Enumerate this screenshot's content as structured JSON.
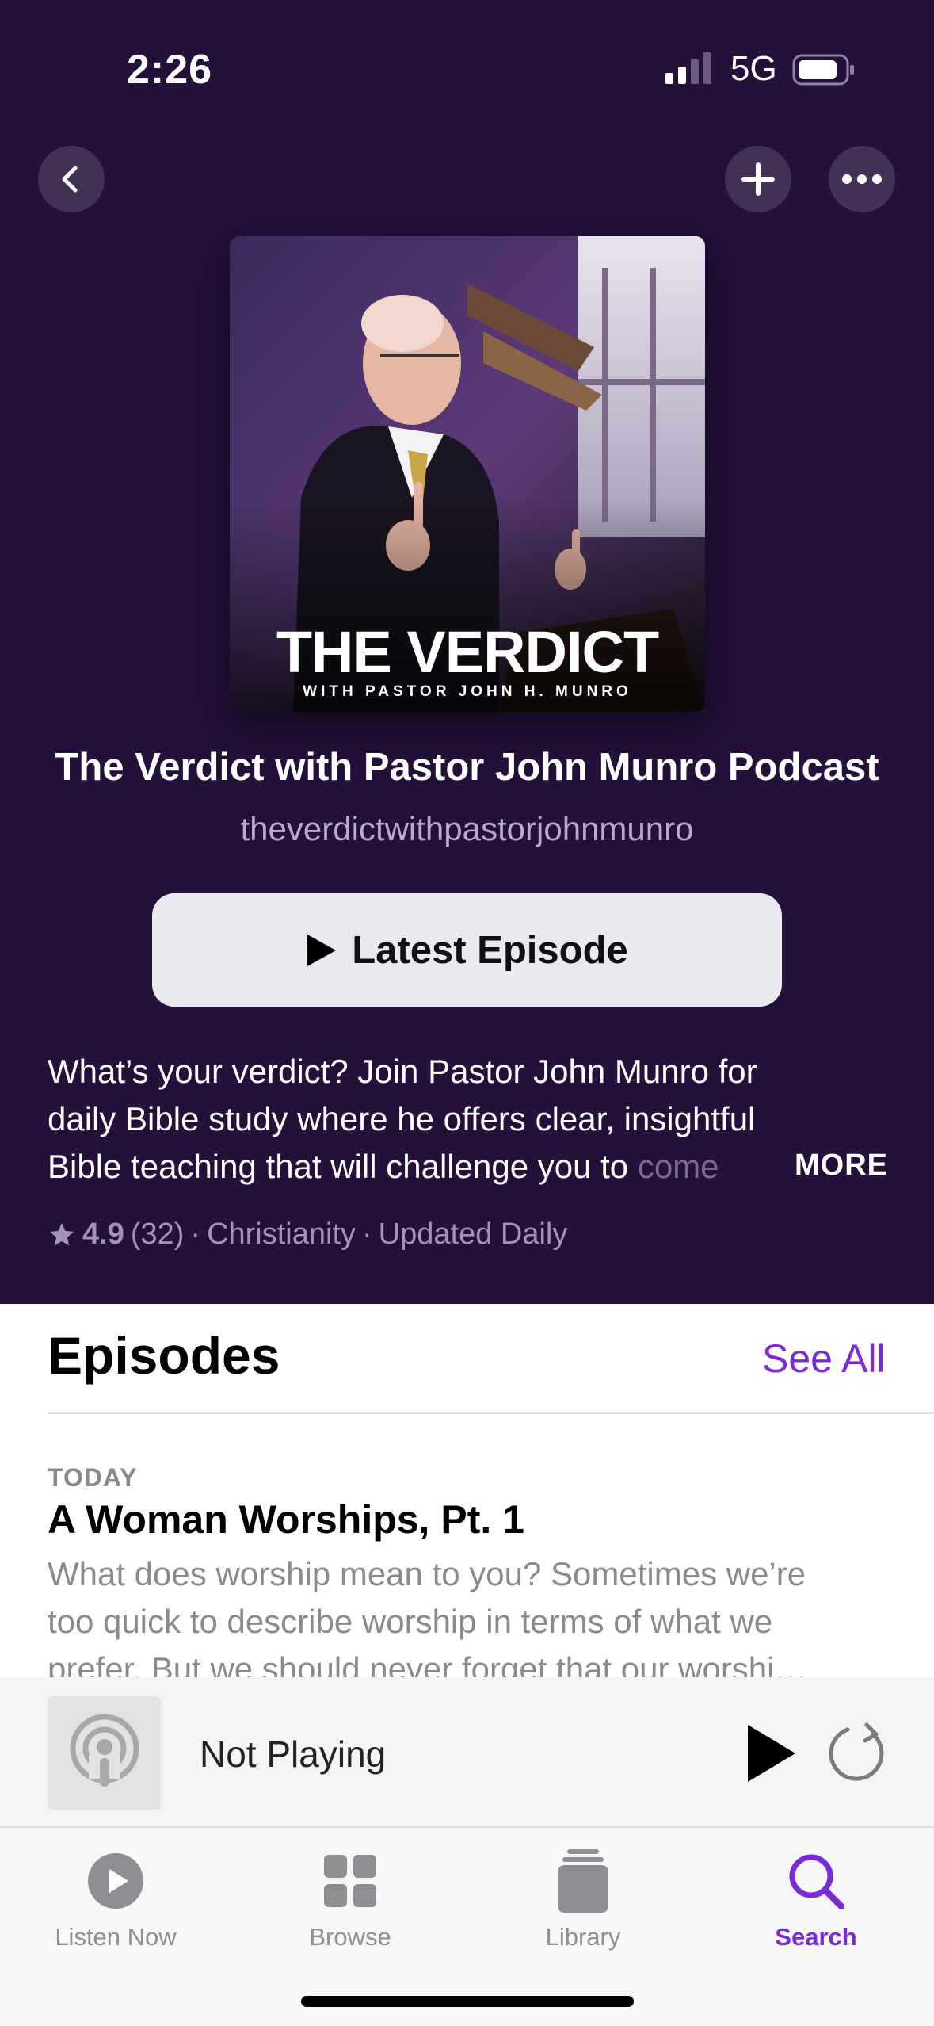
{
  "status_bar": {
    "time": "2:26",
    "network": "5G"
  },
  "podcast": {
    "artwork_title": "THE VERDICT",
    "artwork_subtitle": "WITH PASTOR JOHN H. MUNRO",
    "title": "The Verdict with Pastor John Munro Podcast",
    "author": "theverdictwithpastorjohnmunro",
    "latest_episode_label": "Latest Episode",
    "description_lines": [
      "What’s your verdict? Join Pastor John Munro for",
      "daily Bible study where he offers clear, insightful",
      "Bible teaching that will challenge you to"
    ],
    "description_fade": "come",
    "more_label": "MORE",
    "rating": "4.9",
    "rating_count": "(32)",
    "category": "Christianity",
    "update_frequency": "Updated Daily",
    "meta_separator": "·"
  },
  "episodes": {
    "heading": "Episodes",
    "see_all": "See All",
    "items": [
      {
        "date": "TODAY",
        "title": "A Woman Worships, Pt. 1",
        "description_lines": [
          "What does worship mean to you? Sometimes we’re",
          "too quick to describe worship in terms of what we",
          "prefer. But we should never forget that our worshi…"
        ]
      }
    ]
  },
  "mini_player": {
    "title": "Not Playing"
  },
  "tab_bar": {
    "tabs": [
      {
        "label": "Listen Now",
        "icon": "play-circle-icon"
      },
      {
        "label": "Browse",
        "icon": "grid-icon"
      },
      {
        "label": "Library",
        "icon": "stack-icon"
      },
      {
        "label": "Search",
        "icon": "search-icon"
      }
    ],
    "active_tab": "Search"
  },
  "colors": {
    "hero_background": "#25103a",
    "accent": "#7a2bd6",
    "author_text": "#bda9cf",
    "meta_text": "#a393b4"
  }
}
